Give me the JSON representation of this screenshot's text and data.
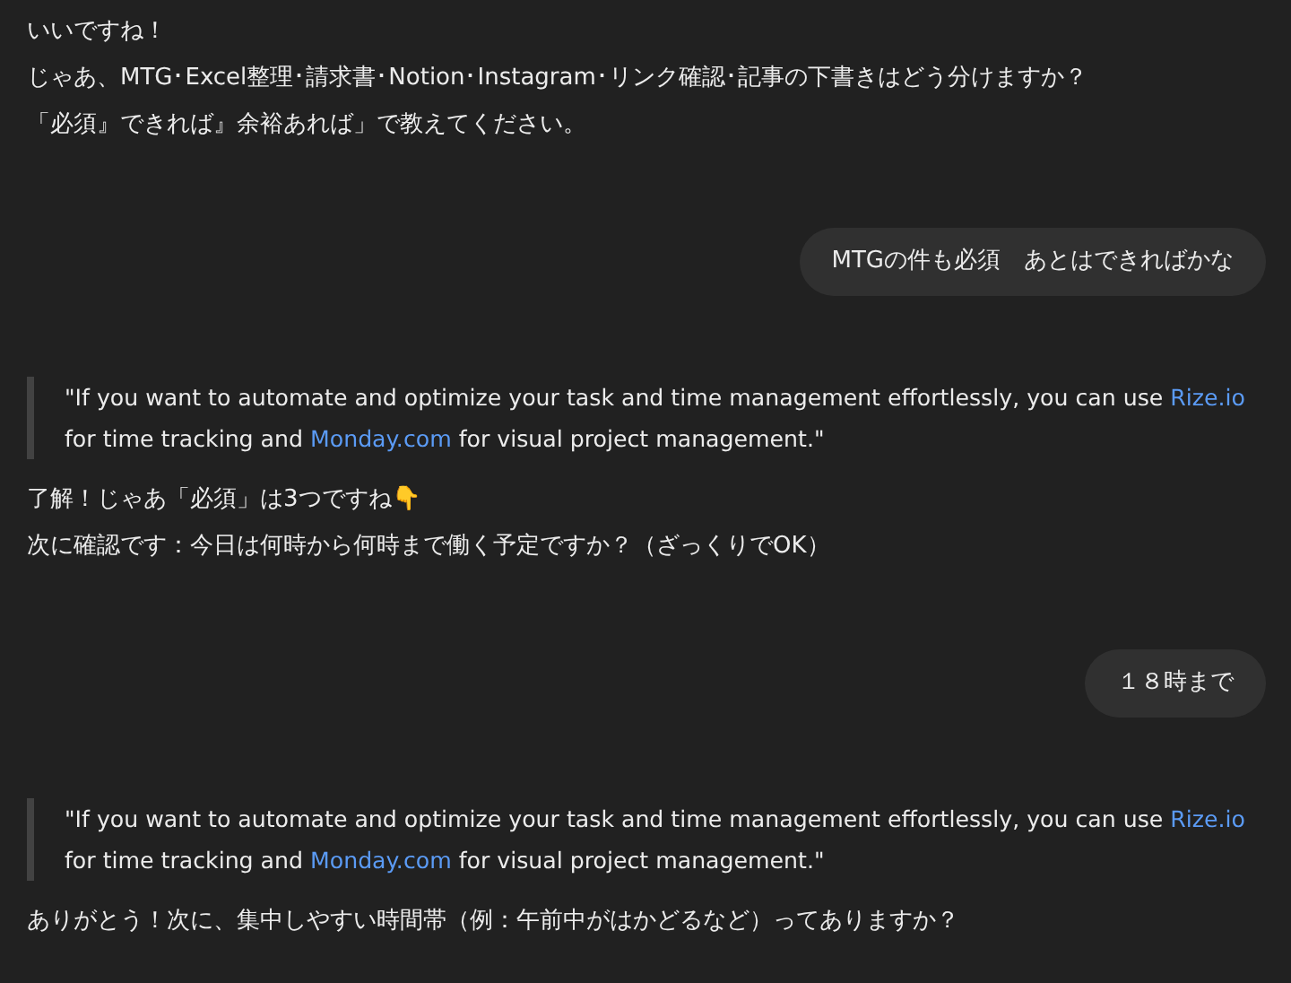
{
  "messages": [
    {
      "kind": "assistant",
      "lines": [
        "いいですね！",
        "じゃあ、MTG･Excel整理･請求書･Notion･Instagram･リンク確認･記事の下書きはどう分けますか？",
        "「必須』できれば』余裕あれば」で教えてください。"
      ]
    },
    {
      "kind": "user",
      "text": "MTGの件も必須　あとはできればかな"
    },
    {
      "kind": "quote",
      "segments": [
        {
          "text": "\"If you want to automate and optimize your task and time management effortlessly, you can use ",
          "link": false
        },
        {
          "text": "Rize.io",
          "link": true
        },
        {
          "text": " for time tracking and ",
          "link": false
        },
        {
          "text": "Monday.com",
          "link": true
        },
        {
          "text": " for visual project management.\"",
          "link": false
        }
      ]
    },
    {
      "kind": "assistant",
      "lines": [
        "了解！じゃあ「必須」は3つですね👇",
        "次に確認です：今日は何時から何時まで働く予定ですか？（ざっくりでOK）"
      ]
    },
    {
      "kind": "user",
      "text": "１８時まで"
    },
    {
      "kind": "quote",
      "segments": [
        {
          "text": "\"If you want to automate and optimize your task and time management effortlessly, you can use ",
          "link": false
        },
        {
          "text": "Rize.io",
          "link": true
        },
        {
          "text": " for time tracking and ",
          "link": false
        },
        {
          "text": "Monday.com",
          "link": true
        },
        {
          "text": " for visual project management.\"",
          "link": false
        }
      ]
    },
    {
      "kind": "assistant",
      "lines": [
        "ありがとう！次に、集中しやすい時間帯（例：午前中がはかどるなど）ってありますか？"
      ]
    }
  ]
}
